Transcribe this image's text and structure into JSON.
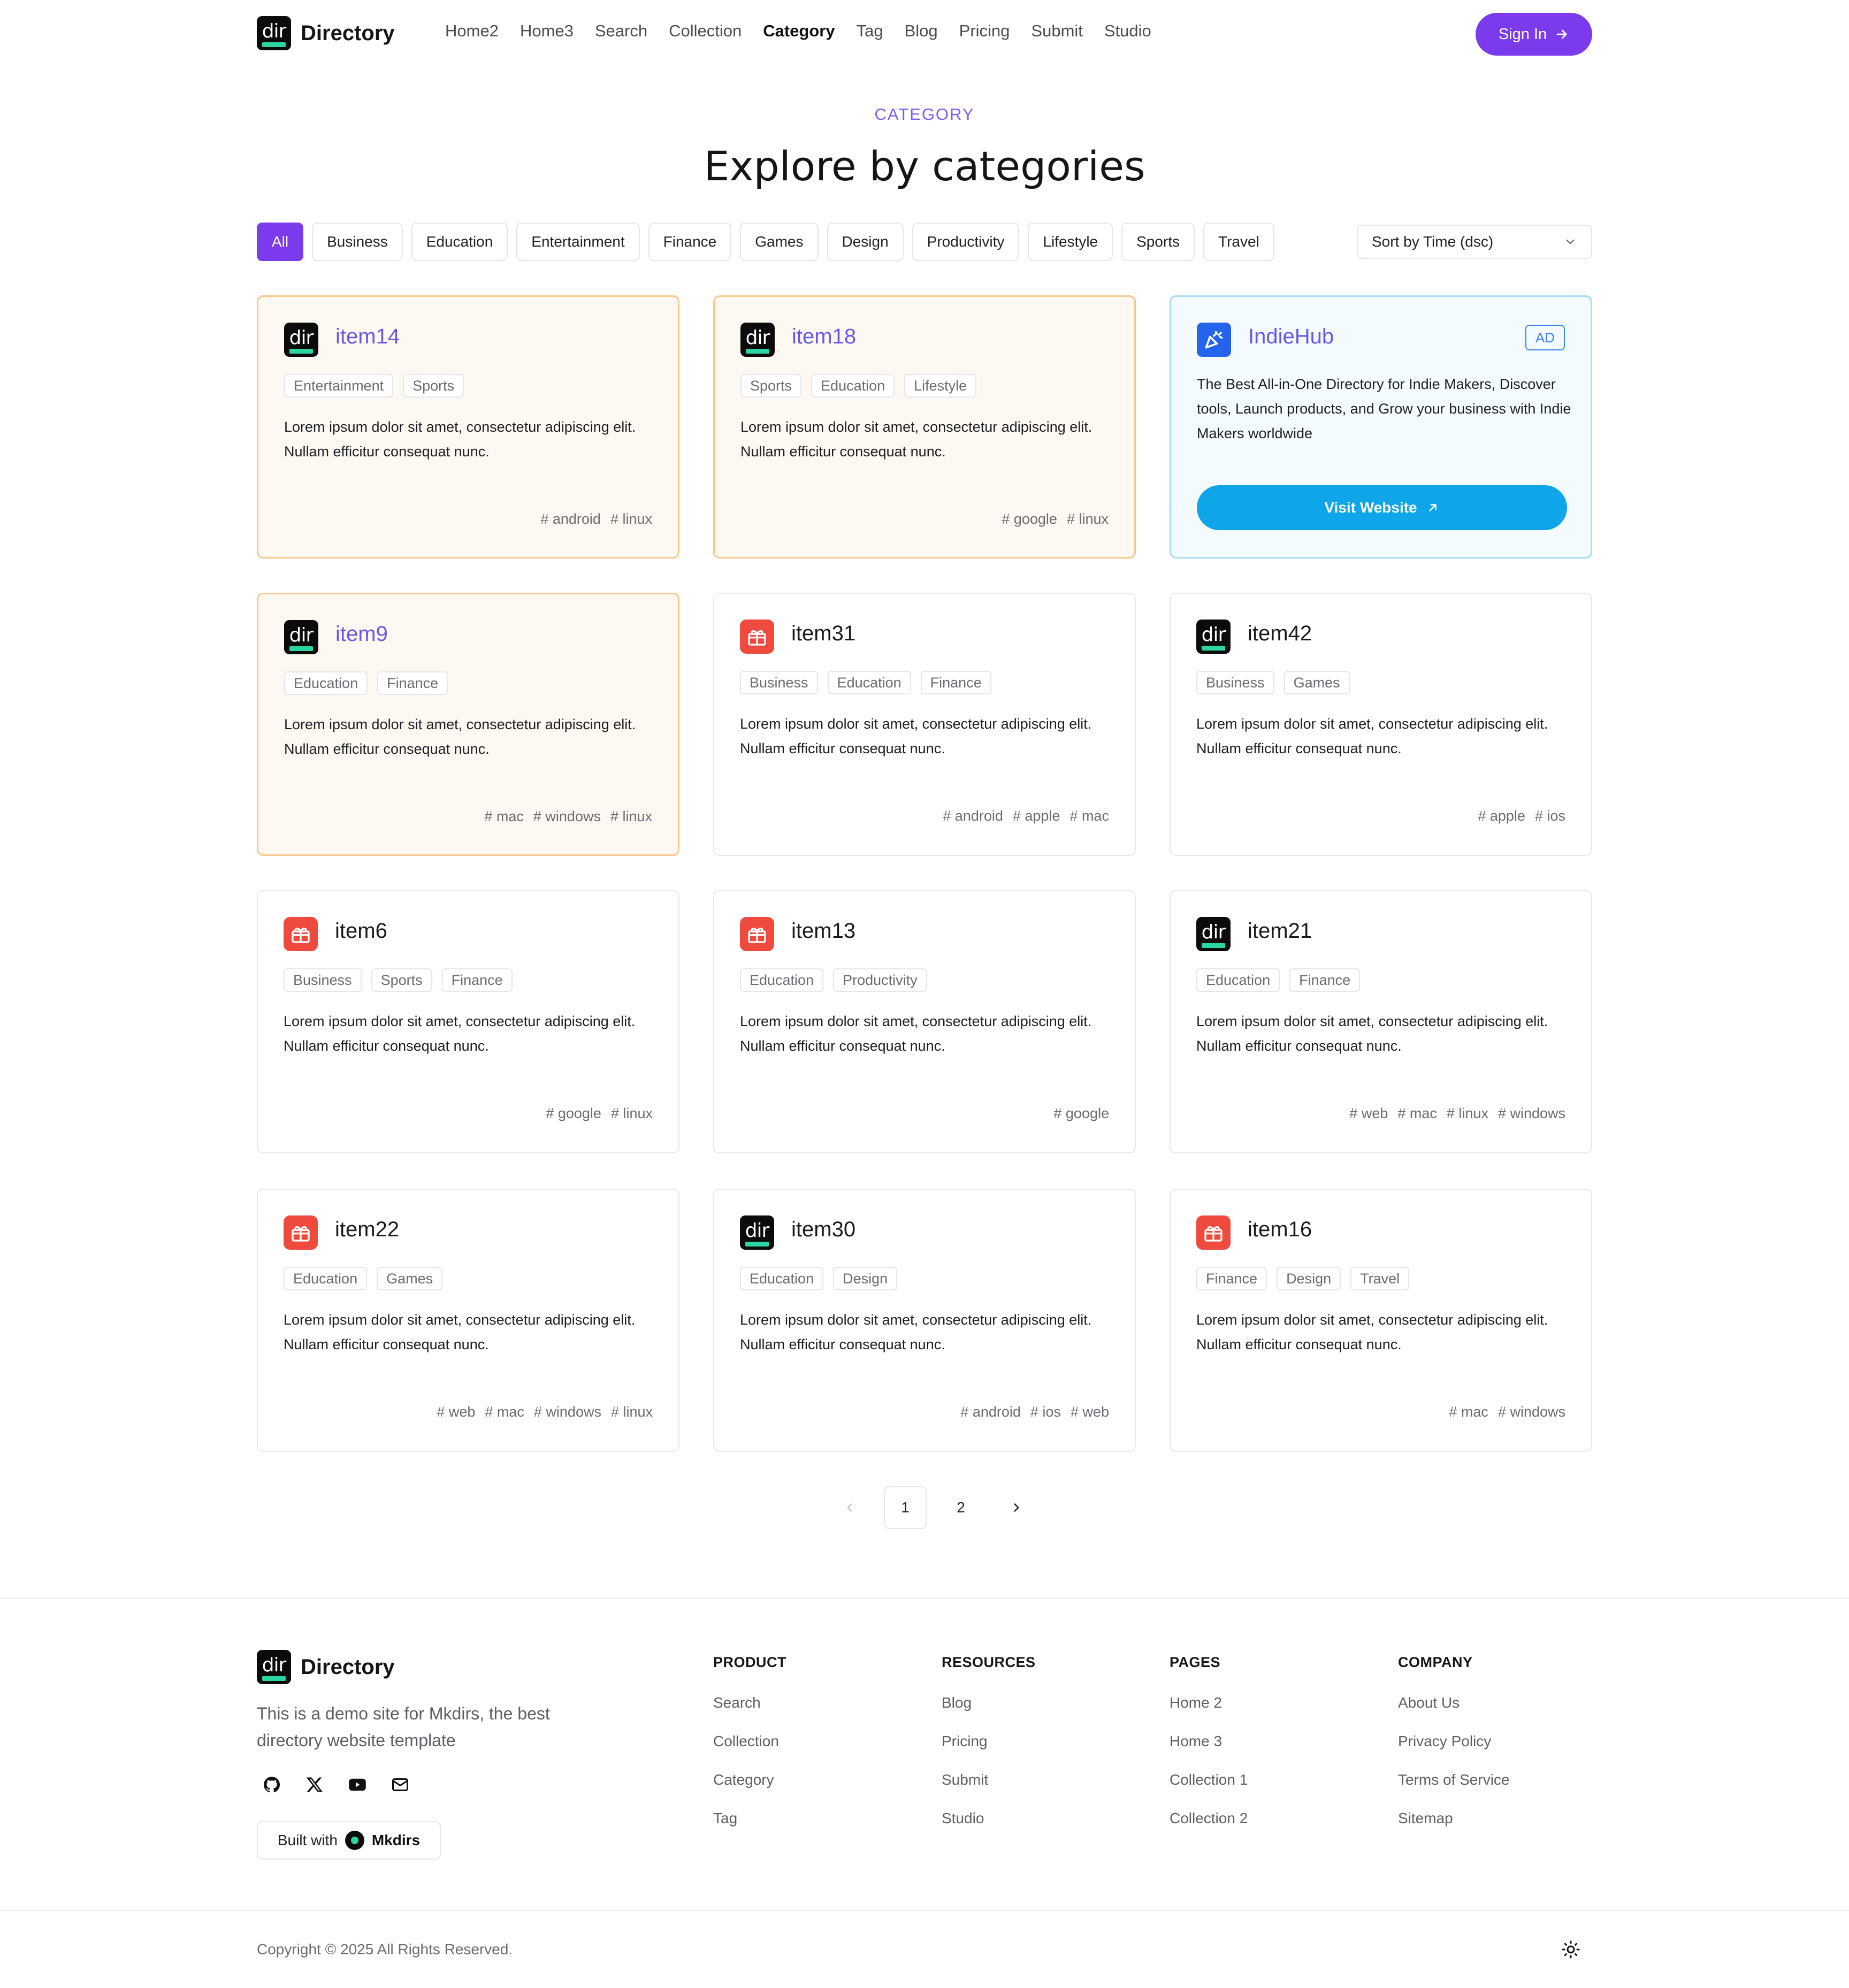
{
  "header": {
    "logo_text": "Directory",
    "logo_icon_text": "dir",
    "nav": [
      "Home2",
      "Home3",
      "Search",
      "Collection",
      "Category",
      "Tag",
      "Blog",
      "Pricing",
      "Submit",
      "Studio"
    ],
    "active_nav": "Category",
    "signin_label": "Sign In"
  },
  "hero": {
    "eyebrow": "CATEGORY",
    "title": "Explore by categories"
  },
  "filters": {
    "chips": [
      "All",
      "Business",
      "Education",
      "Entertainment",
      "Finance",
      "Games",
      "Design",
      "Productivity",
      "Lifestyle",
      "Sports",
      "Travel"
    ],
    "active": "All",
    "sort_label": "Sort by Time (dsc)"
  },
  "cards": [
    {
      "name": "item14",
      "icon": "dir-logo-icon",
      "featured": true,
      "tags": [
        "Entertainment",
        "Sports"
      ],
      "desc": "Lorem ipsum dolor sit amet, consectetur adipiscing elit. Nullam efficitur consequat nunc.",
      "hashes": [
        "# android",
        "# linux"
      ]
    },
    {
      "name": "item18",
      "icon": "dir-logo-icon",
      "featured": true,
      "tags": [
        "Sports",
        "Education",
        "Lifestyle"
      ],
      "desc": "Lorem ipsum dolor sit amet, consectetur adipiscing elit. Nullam efficitur consequat nunc.",
      "hashes": [
        "# google",
        "# linux"
      ]
    },
    {
      "name": "item9",
      "icon": "dir-logo-icon",
      "featured": true,
      "tags": [
        "Education",
        "Finance"
      ],
      "desc": "Lorem ipsum dolor sit amet, consectetur adipiscing elit. Nullam efficitur consequat nunc.",
      "hashes": [
        "# mac",
        "# windows",
        "# linux"
      ]
    },
    {
      "name": "item31",
      "icon": "gift-icon",
      "featured": false,
      "tags": [
        "Business",
        "Education",
        "Finance"
      ],
      "desc": "Lorem ipsum dolor sit amet, consectetur adipiscing elit. Nullam efficitur consequat nunc.",
      "hashes": [
        "# android",
        "# apple",
        "# mac"
      ]
    },
    {
      "name": "item42",
      "icon": "dir-logo-icon",
      "featured": false,
      "tags": [
        "Business",
        "Games"
      ],
      "desc": "Lorem ipsum dolor sit amet, consectetur adipiscing elit. Nullam efficitur consequat nunc.",
      "hashes": [
        "# apple",
        "# ios"
      ]
    },
    {
      "name": "item6",
      "icon": "gift-icon",
      "featured": false,
      "tags": [
        "Business",
        "Sports",
        "Finance"
      ],
      "desc": "Lorem ipsum dolor sit amet, consectetur adipiscing elit. Nullam efficitur consequat nunc.",
      "hashes": [
        "# google",
        "# linux"
      ]
    },
    {
      "name": "item13",
      "icon": "gift-icon",
      "featured": false,
      "tags": [
        "Education",
        "Productivity"
      ],
      "desc": "Lorem ipsum dolor sit amet, consectetur adipiscing elit. Nullam efficitur consequat nunc.",
      "hashes": [
        "# google"
      ]
    },
    {
      "name": "item21",
      "icon": "dir-logo-icon",
      "featured": false,
      "tags": [
        "Education",
        "Finance"
      ],
      "desc": "Lorem ipsum dolor sit amet, consectetur adipiscing elit. Nullam efficitur consequat nunc.",
      "hashes": [
        "# web",
        "# mac",
        "# linux",
        "# windows"
      ]
    },
    {
      "name": "item22",
      "icon": "gift-icon",
      "featured": false,
      "tags": [
        "Education",
        "Games"
      ],
      "desc": "Lorem ipsum dolor sit amet, consectetur adipiscing elit. Nullam efficitur consequat nunc.",
      "hashes": [
        "# web",
        "# mac",
        "# windows",
        "# linux"
      ]
    },
    {
      "name": "item30",
      "icon": "dir-logo-icon",
      "featured": false,
      "tags": [
        "Education",
        "Design"
      ],
      "desc": "Lorem ipsum dolor sit amet, consectetur adipiscing elit. Nullam efficitur consequat nunc.",
      "hashes": [
        "# android",
        "# ios",
        "# web"
      ]
    },
    {
      "name": "item16",
      "icon": "gift-icon",
      "featured": false,
      "tags": [
        "Finance",
        "Design",
        "Travel"
      ],
      "desc": "Lorem ipsum dolor sit amet, consectetur adipiscing elit. Nullam efficitur consequat nunc.",
      "hashes": [
        "# mac",
        "# windows"
      ]
    }
  ],
  "ad": {
    "name": "IndieHub",
    "badge": "AD",
    "desc": "The Best All-in-One Directory for Indie Makers, Discover tools, Launch products, and Grow your business with Indie Makers worldwide",
    "button": "Visit Website"
  },
  "pagination": {
    "pages": [
      "1",
      "2"
    ],
    "current": "1"
  },
  "footer": {
    "logo_text": "Directory",
    "tagline": "This is a demo site for Mkdirs, the best directory website template",
    "social": [
      "github-icon",
      "x-icon",
      "youtube-icon",
      "mail-icon"
    ],
    "built_with": "Built with",
    "built_brand": "Mkdirs",
    "columns": [
      {
        "title": "PRODUCT",
        "links": [
          "Search",
          "Collection",
          "Category",
          "Tag"
        ]
      },
      {
        "title": "RESOURCES",
        "links": [
          "Blog",
          "Pricing",
          "Submit",
          "Studio"
        ]
      },
      {
        "title": "PAGES",
        "links": [
          "Home 2",
          "Home 3",
          "Collection 1",
          "Collection 2"
        ]
      },
      {
        "title": "COMPANY",
        "links": [
          "About Us",
          "Privacy Policy",
          "Terms of Service",
          "Sitemap"
        ]
      }
    ],
    "copyright": "Copyright © 2025 All Rights Reserved."
  },
  "colors": {
    "accent": "#7c3aed",
    "featured_border": "#f7c98e",
    "ad_border": "#a9dcf7",
    "visit_button": "#0ea5e9"
  }
}
